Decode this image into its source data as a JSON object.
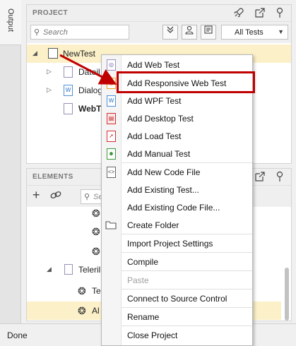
{
  "sidebar": {
    "output_label": "Output"
  },
  "project": {
    "title": "PROJECT",
    "search_placeholder": "Search",
    "filter_value": "All Tests",
    "tree": [
      {
        "label": "NewTest",
        "selected": true
      },
      {
        "label": "Dateil"
      },
      {
        "label": "Dialog"
      },
      {
        "label": "WebT"
      }
    ]
  },
  "elements": {
    "title": "ELEMENTS",
    "search_placeholder": "Searc",
    "rows": [
      {
        "label": ""
      },
      {
        "label": ""
      },
      {
        "label": ""
      },
      {
        "label": "Teleril"
      },
      {
        "label": "Te"
      },
      {
        "label": "Al"
      }
    ]
  },
  "context_menu": {
    "items": [
      {
        "label": "Add Web Test",
        "icon": "web-test-icon"
      },
      {
        "label": "Add Responsive Web Test",
        "icon": "responsive-web-test-icon"
      },
      {
        "label": "Add WPF Test",
        "icon": "wpf-test-icon"
      },
      {
        "label": "Add Desktop Test",
        "icon": "desktop-test-icon"
      },
      {
        "label": "Add Load Test",
        "icon": "load-test-icon"
      },
      {
        "label": "Add Manual Test",
        "icon": "manual-test-icon"
      },
      {
        "label": "Add New Code File",
        "icon": "code-file-icon"
      },
      {
        "label": "Add Existing Test..."
      },
      {
        "label": "Add Existing Code File..."
      },
      {
        "label": "Create Folder",
        "icon": "folder-icon"
      },
      {
        "label": "Import Project Settings"
      },
      {
        "label": "Compile"
      },
      {
        "label": "Paste",
        "disabled": true
      },
      {
        "label": "Connect to Source Control"
      },
      {
        "label": "Rename"
      },
      {
        "label": "Close Project"
      }
    ]
  },
  "status": {
    "text": "Done"
  },
  "colors": {
    "highlight": "#c00000",
    "selection": "#fbf0c8"
  }
}
